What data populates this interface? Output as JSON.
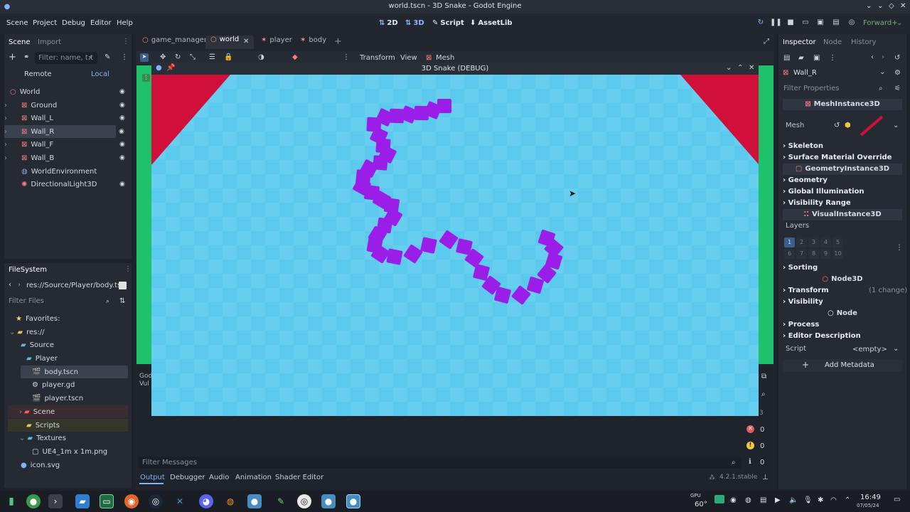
{
  "window": {
    "title": "world.tscn - 3D Snake - Godot Engine"
  },
  "menu": {
    "items": [
      "Scene",
      "Project",
      "Debug",
      "Editor",
      "Help"
    ],
    "modes": {
      "m2d": "2D",
      "m3d": "3D",
      "script": "Script",
      "assetlib": "AssetLib"
    },
    "renderer": "Forward+"
  },
  "scene_panel": {
    "tab_scene": "Scene",
    "tab_import": "Import",
    "filter_placeholder": "Filter: name, t:t",
    "remote": "Remote",
    "local": "Local",
    "nodes": [
      {
        "label": "World"
      },
      {
        "label": "Ground"
      },
      {
        "label": "Wall_L"
      },
      {
        "label": "Wall_R"
      },
      {
        "label": "Wall_F"
      },
      {
        "label": "Wall_B"
      },
      {
        "label": "WorldEnvironment"
      },
      {
        "label": "DirectionalLight3D"
      }
    ]
  },
  "filesystem": {
    "title": "FileSystem",
    "path": "res://Source/Player/body.ts",
    "filter_placeholder": "Filter Files",
    "items": [
      {
        "label": "Favorites:"
      },
      {
        "label": "res://"
      },
      {
        "label": "Source"
      },
      {
        "label": "Player"
      },
      {
        "label": "body.tscn"
      },
      {
        "label": "player.gd"
      },
      {
        "label": "player.tscn"
      },
      {
        "label": "Scene"
      },
      {
        "label": "Scripts"
      },
      {
        "label": "Textures"
      },
      {
        "label": "UE4_1m x 1m.png"
      },
      {
        "label": "icon.svg"
      }
    ]
  },
  "editor_tabs": [
    {
      "label": "game_manager"
    },
    {
      "label": "world"
    },
    {
      "label": "player"
    },
    {
      "label": "body"
    }
  ],
  "viewport_toolbar": {
    "transform": "Transform",
    "view": "View",
    "mesh": "Mesh"
  },
  "game_window": {
    "title": "3D Snake (DEBUG)",
    "colors": {
      "floor": "#5ccaef",
      "wall": "#d0103a",
      "snake": "#9b1ee8"
    }
  },
  "console": {
    "line1": "God",
    "line2": "Vul",
    "filter_placeholder": "Filter Messages",
    "badge_count": "3",
    "errors": "0",
    "warnings": "0",
    "messages": "0",
    "version": "4.2.1.stable",
    "tabs": [
      "Output",
      "Debugger",
      "Audio",
      "Animation",
      "Shader Editor"
    ]
  },
  "inspector": {
    "tabs": [
      "Inspector",
      "Node",
      "History"
    ],
    "node": "Wall_R",
    "filter_placeholder": "Filter Properties",
    "class_mesh": "MeshInstance3D",
    "mesh_label": "Mesh",
    "skeleton": "Skeleton",
    "surface_override": "Surface Material Override",
    "class_geometry": "GeometryInstance3D",
    "geometry": "Geometry",
    "global_illumination": "Global Illumination",
    "visibility_range": "Visibility Range",
    "class_visual": "VisualInstance3D",
    "layers": "Layers",
    "layer_cells": [
      "1",
      "2",
      "3",
      "4",
      "5",
      "6",
      "7",
      "8",
      "9",
      "10"
    ],
    "sorting": "Sorting",
    "class_node3d": "Node3D",
    "transform": "Transform",
    "transform_change": "(1 change)",
    "visibility": "Visibility",
    "class_node": "Node",
    "process": "Process",
    "editor_description": "Editor Description",
    "script_label": "Script",
    "script_value": "<empty>",
    "add_metadata": "Add Metadata"
  },
  "taskbar": {
    "gpu_label": "GPU",
    "gpu_temp": "60°",
    "time": "16:49",
    "date": "07/05/24"
  }
}
